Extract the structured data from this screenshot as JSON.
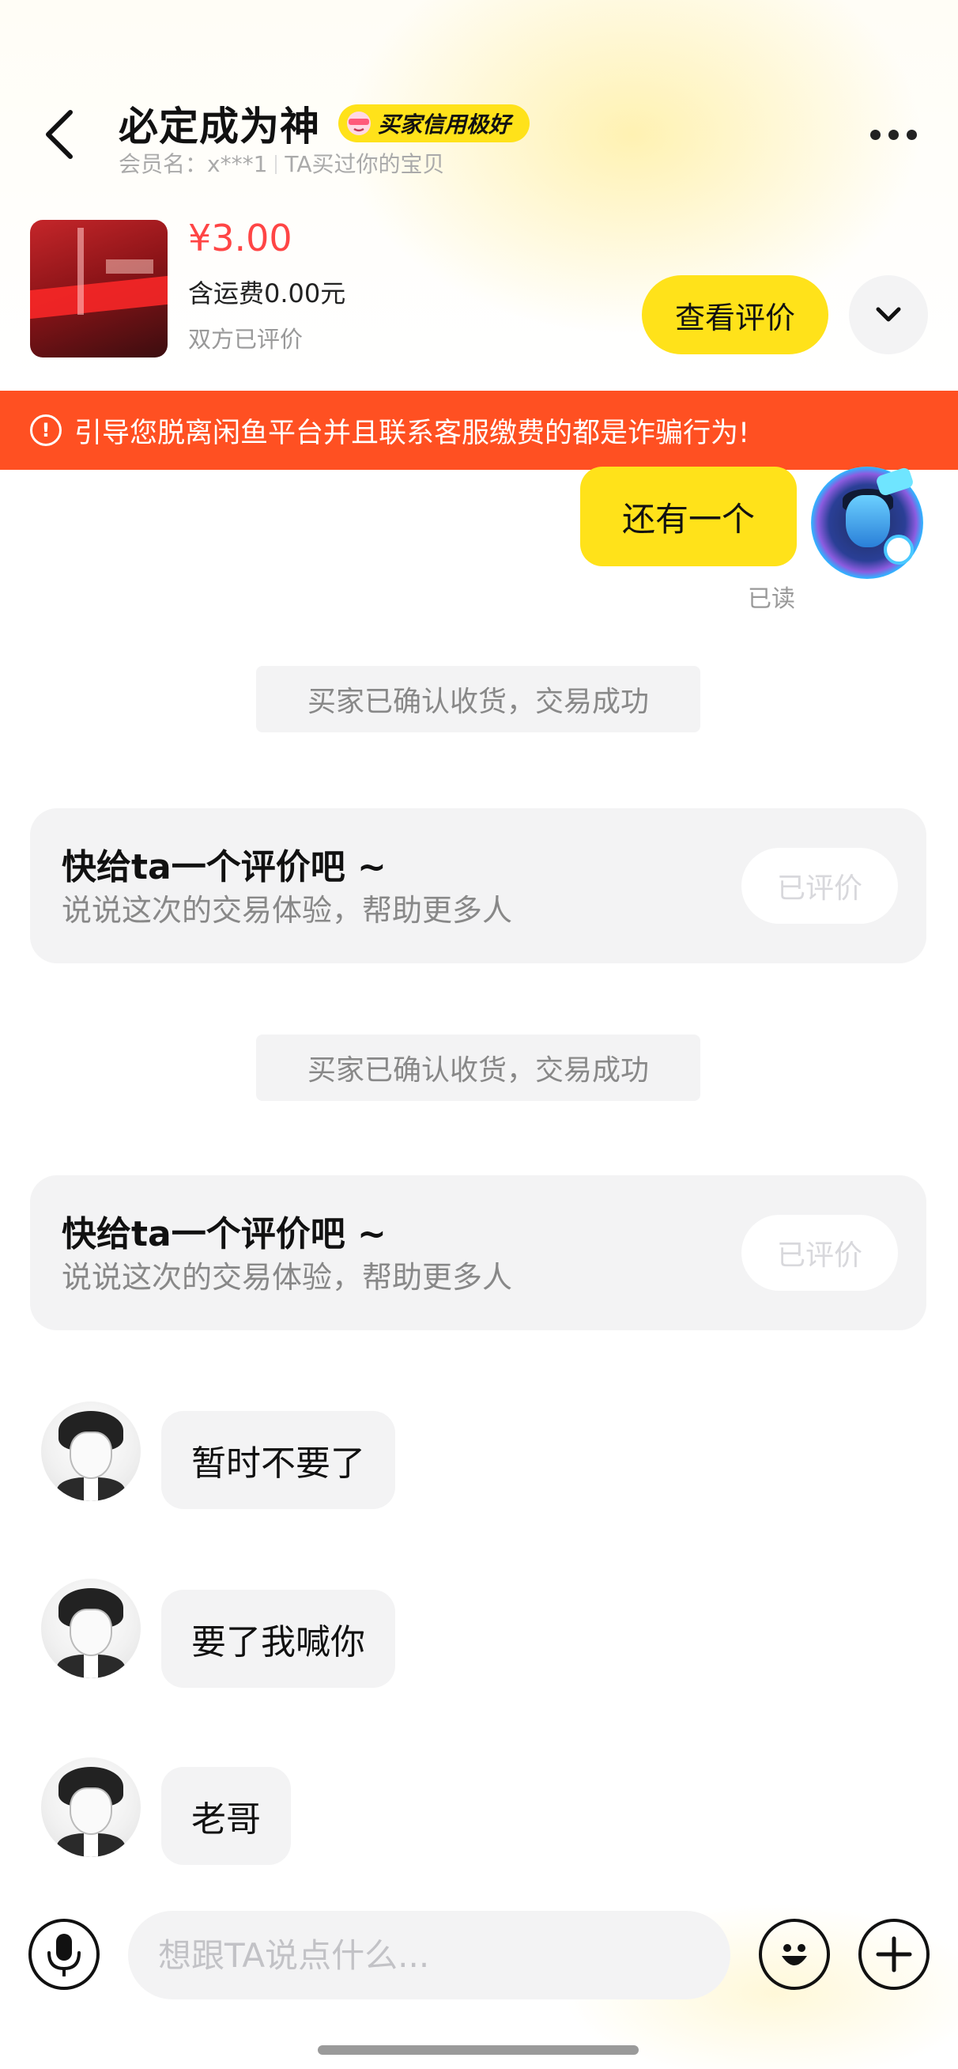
{
  "header": {
    "title": "必定成为神",
    "badge": "买家信用极好",
    "member_label": "会员名：",
    "member_name": "x***1",
    "relation": "TA买过你的宝贝"
  },
  "product": {
    "price": "¥3.00",
    "shipping": "含运费0.00元",
    "status": "双方已评价",
    "view_review_label": "查看评价"
  },
  "warning": {
    "text": "引导您脱离闲鱼平台并且联系客服缴费的都是诈骗行为!",
    "color": "#ff5022"
  },
  "messages": {
    "sent": {
      "text": "还有一个",
      "read_status": "已读"
    },
    "system_1": "买家已确认收货，交易成功",
    "review_prompt_1": {
      "title": "快给ta一个评价吧 ~",
      "subtitle": "说说这次的交易体验，帮助更多人",
      "button": "已评价"
    },
    "system_2": "买家已确认收货，交易成功",
    "review_prompt_2": {
      "title": "快给ta一个评价吧 ~",
      "subtitle": "说说这次的交易体验，帮助更多人",
      "button": "已评价"
    },
    "received": [
      {
        "text": "暂时不要了"
      },
      {
        "text": "要了我喊你"
      },
      {
        "text": "老哥"
      }
    ]
  },
  "input": {
    "placeholder": "想跟TA说点什么..."
  },
  "colors": {
    "accent_yellow": "#ffe21a",
    "price_red": "#ff4545"
  },
  "icons": [
    "back-arrow-icon",
    "credit-emoji-icon",
    "more-dots-icon",
    "chevron-down-icon",
    "alert-circle-icon",
    "microphone-icon",
    "emoji-face-icon",
    "plus-circle-icon"
  ]
}
